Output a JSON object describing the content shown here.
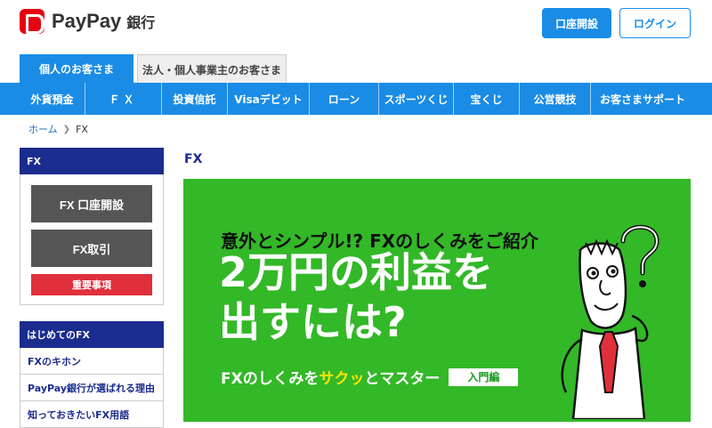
{
  "header": {
    "logo_text": "PayPay",
    "logo_sub": "銀行",
    "open_account": "口座開設",
    "login": "ログイン"
  },
  "tabs": {
    "personal": "個人のお客さま",
    "corporate": "法人・個人事業主のお客さま"
  },
  "nav": [
    "外貨預金",
    "ＦＸ",
    "投資信託",
    "Visaデビット",
    "ローン",
    "スポーツくじ",
    "宝くじ",
    "公営競技",
    "お客さまサポート"
  ],
  "breadcrumb": {
    "home": "ホーム",
    "current": "FX"
  },
  "sidebar": {
    "section1": "FX",
    "btn_open": "FX 口座開設",
    "btn_trade": "FX取引",
    "btn_important": "重要事項",
    "section2": "はじめてのFX",
    "links": [
      "FXのキホン",
      "PayPay銀行が選ばれる理由",
      "知っておきたいFX用語"
    ]
  },
  "main": {
    "title": "FX",
    "banner": {
      "line1": "意外とシンプル!? FXのしくみをご紹介",
      "big1": "2万円の利益を",
      "big2": "出すには?",
      "line3_a": "FXのしくみを",
      "line3_hl": "サクッ",
      "line3_b": "とマスター",
      "badge": "入門編"
    }
  },
  "colors": {
    "brand_blue": "#1a8ce6",
    "navy": "#1b2c8f",
    "banner_green": "#33b828",
    "logo_red": "#e60012"
  }
}
